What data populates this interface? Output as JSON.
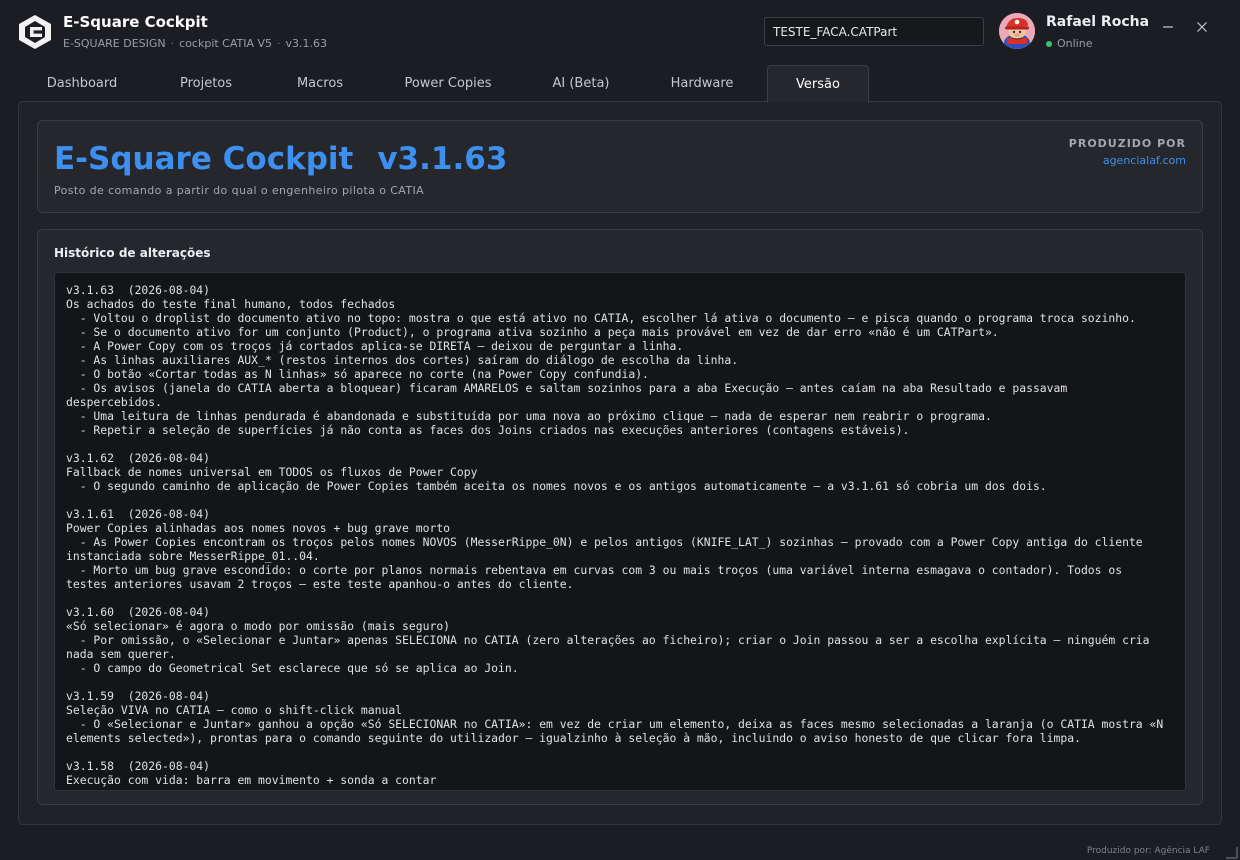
{
  "app": {
    "title": "E-Square Cockpit",
    "company": "E-SQUARE DESIGN",
    "product": "cockpit CATIA V5",
    "version": "v3.1.63",
    "separator": "·"
  },
  "header": {
    "doc_input_value": "TESTE_FACA.CATPart"
  },
  "user": {
    "name": "Rafael Rocha",
    "status": "Online",
    "status_color": "#35c46a"
  },
  "tabs": [
    {
      "label": "Dashboard",
      "active": false
    },
    {
      "label": "Projetos",
      "active": false
    },
    {
      "label": "Macros",
      "active": false
    },
    {
      "label": "Power Copies",
      "active": false
    },
    {
      "label": "AI (Beta)",
      "active": false
    },
    {
      "label": "Hardware",
      "active": false
    },
    {
      "label": "Versão",
      "active": true
    }
  ],
  "hero": {
    "title": "E-Square Cockpit",
    "version": "v3.1.63",
    "subtitle": "Posto de comando a partir do qual o engenheiro pilota o CATIA",
    "produced_by_label": "PRODUZIDO POR",
    "produced_by_link": "agencialaf.com"
  },
  "history": {
    "title": "Histórico de alterações",
    "log": "v3.1.63  (2026-08-04)\nOs achados do teste final humano, todos fechados\n  - Voltou o droplist do documento ativo no topo: mostra o que está ativo no CATIA, escolher lá ativa o documento — e pisca quando o programa troca sozinho.\n  - Se o documento ativo for um conjunto (Product), o programa ativa sozinho a peça mais provável em vez de dar erro «não é um CATPart».\n  - A Power Copy com os troços já cortados aplica-se DIRETA — deixou de perguntar a linha.\n  - As linhas auxiliares AUX_* (restos internos dos cortes) saíram do diálogo de escolha da linha.\n  - O botão «Cortar todas as N linhas» só aparece no corte (na Power Copy confundia).\n  - Os avisos (janela do CATIA aberta a bloquear) ficaram AMARELOS e saltam sozinhos para a aba Execução — antes caíam na aba Resultado e passavam despercebidos.\n  - Uma leitura de linhas pendurada é abandonada e substituída por uma nova ao próximo clique — nada de esperar nem reabrir o programa.\n  - Repetir a seleção de superfícies já não conta as faces dos Joins criados nas execuções anteriores (contagens estáveis).\n\nv3.1.62  (2026-08-04)\nFallback de nomes universal em TODOS os fluxos de Power Copy\n  - O segundo caminho de aplicação de Power Copies também aceita os nomes novos e os antigos automaticamente — a v3.1.61 só cobria um dos dois.\n\nv3.1.61  (2026-08-04)\nPower Copies alinhadas aos nomes novos + bug grave morto\n  - As Power Copies encontram os troços pelos nomes NOVOS (MesserRippe_0N) e pelos antigos (KNIFE_LAT_) sozinhas — provado com a Power Copy antiga do cliente instanciada sobre MesserRippe_01..04.\n  - Morto um bug grave escondido: o corte por planos normais rebentava em curvas com 3 ou mais troços (uma variável interna esmagava o contador). Todos os testes anteriores usavam 2 troços — este teste apanhou-o antes do cliente.\n\nv3.1.60  (2026-08-04)\n«Só selecionar» é agora o modo por omissão (mais seguro)\n  - Por omissão, o «Selecionar e Juntar» apenas SELECIONA no CATIA (zero alterações ao ficheiro); criar o Join passou a ser a escolha explícita — ninguém cria nada sem querer.\n  - O campo do Geometrical Set esclarece que só se aplica ao Join.\n\nv3.1.59  (2026-08-04)\nSeleção VIVA no CATIA — como o shift-click manual\n  - O «Selecionar e Juntar» ganhou a opção «Só SELECIONAR no CATIA»: em vez de criar um elemento, deixa as faces mesmo selecionadas a laranja (o CATIA mostra «N elements selected»), prontas para o comando seguinte do utilizador — igualzinho à seleção à mão, incluindo o aviso honesto de que clicar fora limpa.\n\nv3.1.58  (2026-08-04)\nExecução com vida: barra em movimento + sonda a contar"
  },
  "footer": {
    "text": "Produzido por: Agência LAF"
  },
  "colors": {
    "accent": "#3d8ff0",
    "background": "#1b1d22",
    "panel": "#25272d"
  }
}
